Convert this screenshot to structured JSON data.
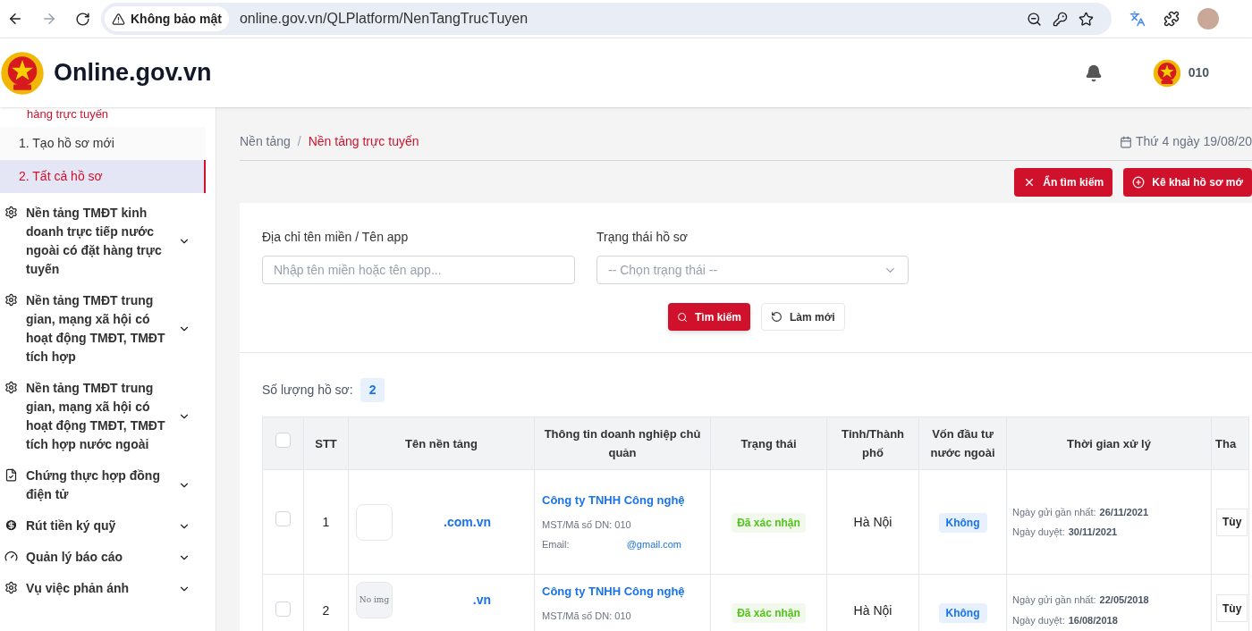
{
  "browser": {
    "security_label": "Không bảo mật",
    "url": "online.gov.vn/QLPlatform/NenTangTrucTuyen"
  },
  "header": {
    "site_name": "Online.gov.vn",
    "user": "010"
  },
  "sidebar": {
    "section_tail": "hàng trực tuyến",
    "subitems": [
      {
        "label": "1. Tạo hồ sơ mới",
        "selected": false
      },
      {
        "label": "2. Tất cả hồ sơ",
        "selected": true
      }
    ],
    "groups": [
      {
        "label": "Nền tảng TMĐT kinh doanh trực tiếp nước ngoài có đặt hàng trực tuyến",
        "kind": "gear",
        "expanded": false
      },
      {
        "label": "Nền tảng TMĐT trung gian, mạng xã hội có hoạt động TMĐT, TMĐT tích hợp",
        "kind": "gear",
        "expanded": false
      },
      {
        "label": "Nền tảng TMĐT trung gian, mạng xã hội có hoạt động TMĐT, TMĐT tích hợp nước ngoài",
        "kind": "gear",
        "expanded": false
      },
      {
        "label": "Chứng thực hợp đồng điện tử",
        "kind": "document",
        "expanded": false
      },
      {
        "label": "Rút tiền ký quỹ",
        "kind": "money",
        "expanded": false
      },
      {
        "label": "Quản lý báo cáo",
        "kind": "gauge",
        "expanded": false
      },
      {
        "label": "Vụ việc phản ánh",
        "kind": "gear",
        "expanded": false
      }
    ]
  },
  "breadcrumb": [
    {
      "label": "Nền tảng",
      "selected": false
    },
    {
      "label": "Nền tảng trực tuyến",
      "selected": true
    }
  ],
  "breadcrumb_separator": "/",
  "date": "Thứ 4 ngày 19/08/20",
  "actions": [
    {
      "label": "Ẩn tìm kiếm",
      "kind": "close"
    },
    {
      "label": "Kê khai hồ sơ mớ",
      "kind": "add"
    }
  ],
  "filters": {
    "domain": {
      "label": "Địa chỉ tên miền / Tên app",
      "placeholder": "Nhập tên miền hoặc tên app..."
    },
    "status": {
      "label": "Trạng thái hồ sơ",
      "placeholder": "-- Chọn trạng thái --"
    },
    "buttons": [
      {
        "label": "Tìm kiếm",
        "kind": "search"
      },
      {
        "label": "Làm mới",
        "kind": "reset"
      }
    ]
  },
  "count": {
    "label": "Số lượng hồ sơ:",
    "value": "2"
  },
  "table": {
    "all_checked": false,
    "columns": [
      "STT",
      "Tên nền tảng",
      "Thông tin doanh nghiệp chủ quản",
      "Trạng thái",
      "Tỉnh/Thành phố",
      "Vốn đầu tư nước ngoài",
      "Thời gian xử lý",
      "Tha"
    ],
    "rows": [
      {
        "checked": false,
        "stt": "1",
        "thumb": "",
        "name": ".com.vn",
        "company": "Công ty TNHH Công nghệ",
        "tax_id": "MST/Mã số DN: 010",
        "email_label": "Email:",
        "email": "@gmail.com",
        "status": "Đã xác nhận",
        "city": "Hà Nội",
        "foreign_capital": "Không",
        "sent_label": "Ngày gửi gần nhất:",
        "sent": "26/11/2021",
        "approved_label": "Ngày duyệt:",
        "approved": "30/11/2021",
        "action": "Tùy"
      },
      {
        "checked": false,
        "stt": "2",
        "thumb": "No img",
        "name": ".vn",
        "company": "Công ty TNHH Công nghệ",
        "tax_id": "MST/Mã số DN: 010",
        "status": "Đã xác nhận",
        "city": "Hà Nội",
        "foreign_capital": "Không",
        "sent_label": "Ngày gửi gần nhất:",
        "sent": "22/05/2018",
        "approved_label": "Ngày duyệt:",
        "approved": "16/08/2018",
        "action": "Tùy"
      }
    ]
  }
}
